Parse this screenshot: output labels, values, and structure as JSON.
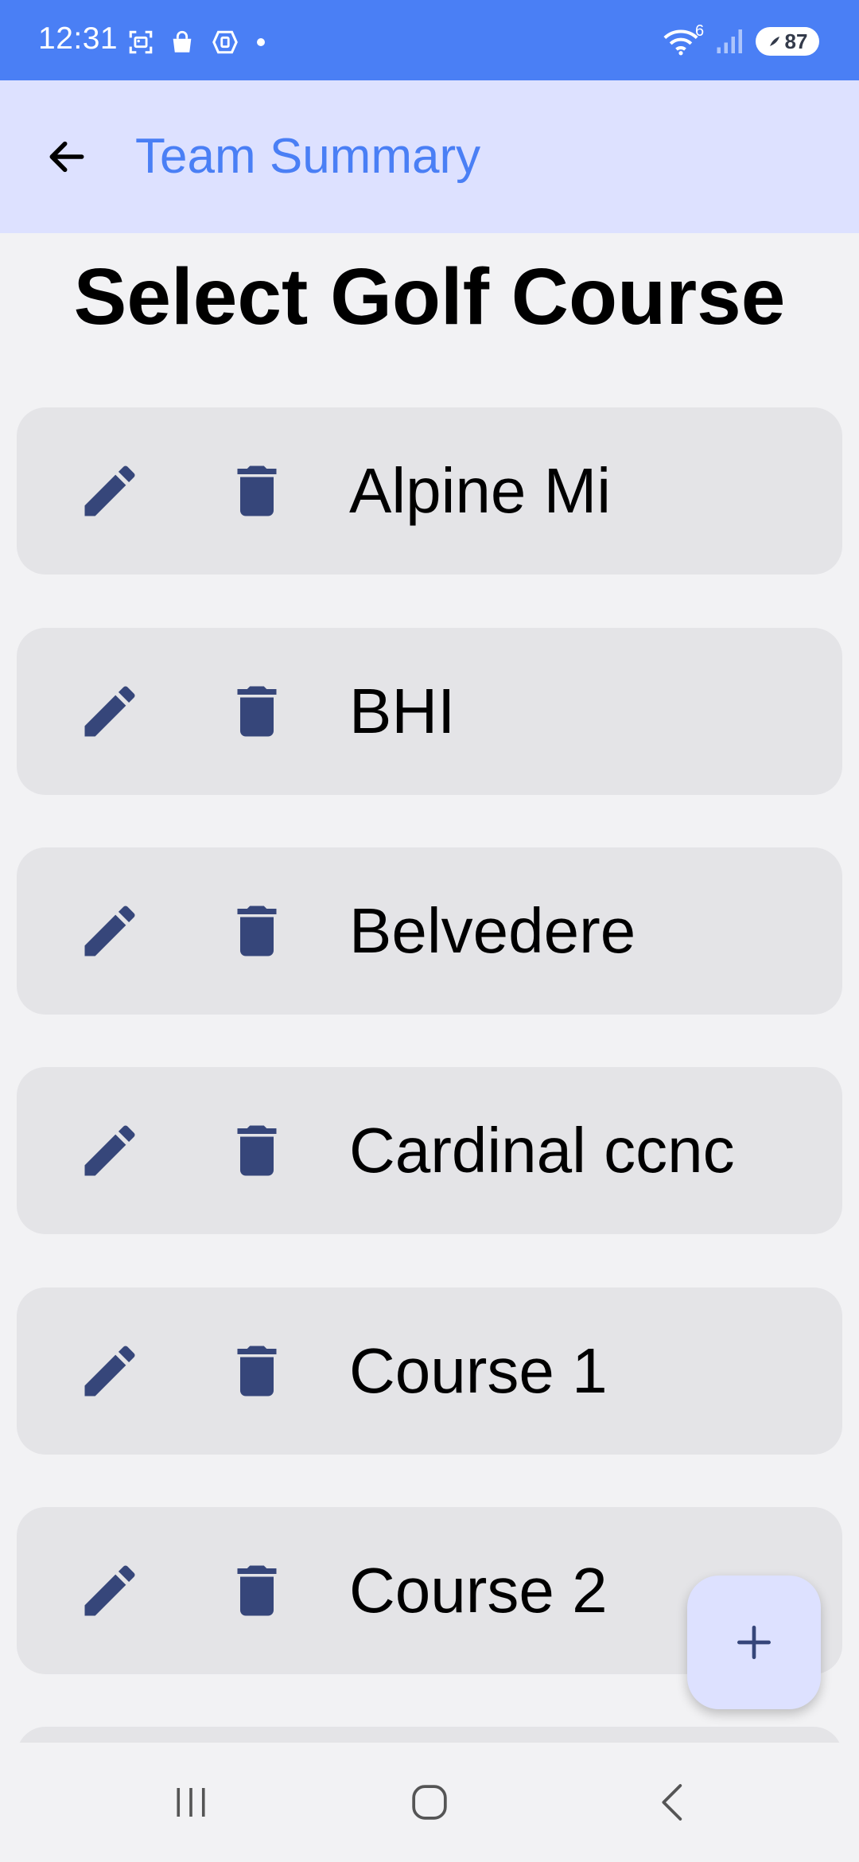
{
  "status_bar": {
    "time": "12:31",
    "icons": [
      "screenshot-icon",
      "shopping-bag-icon",
      "app-notification-icon",
      "dot-icon"
    ],
    "wifi_label": "6",
    "battery_level": "87"
  },
  "app_bar": {
    "title": "Team Summary",
    "back_icon": "arrow-back-icon"
  },
  "page": {
    "heading": "Select Golf Course"
  },
  "courses": [
    {
      "name": "Alpine Mi"
    },
    {
      "name": "BHI"
    },
    {
      "name": "Belvedere"
    },
    {
      "name": "Cardinal ccnc"
    },
    {
      "name": "Course 1"
    },
    {
      "name": "Course 2"
    },
    {
      "name": ""
    }
  ],
  "fab": {
    "icon": "plus-icon",
    "label": "+"
  },
  "nav_bar": {
    "items": [
      "recent-apps-icon",
      "home-icon",
      "back-icon"
    ]
  },
  "colors": {
    "status_bar": "#4a7ff5",
    "app_bar": "#dde1ff",
    "title": "#4a7ff5",
    "background": "#f2f2f4",
    "card": "#e4e4e7",
    "icon": "#36467a"
  }
}
